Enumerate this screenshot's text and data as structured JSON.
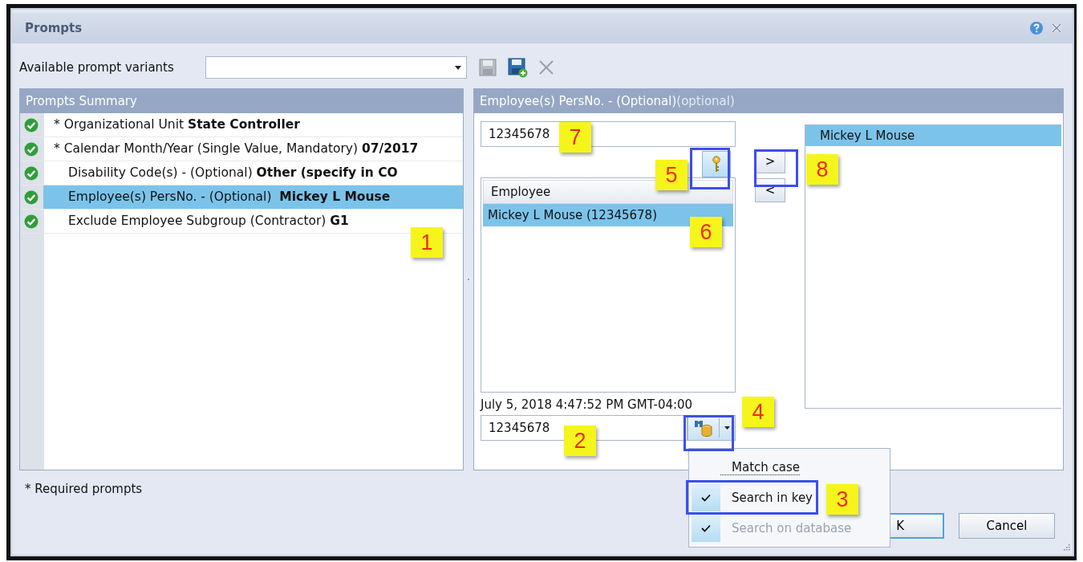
{
  "window": {
    "title": "Prompts"
  },
  "variants": {
    "label": "Available prompt variants"
  },
  "summary": {
    "title": "Prompts Summary",
    "items": [
      {
        "text": "* Organizational Unit **State Controller**",
        "required": true,
        "selected": false
      },
      {
        "text": "* Calendar Month/Year (Single Value, Mandatory) **07/2017**",
        "required": true,
        "selected": false
      },
      {
        "text": "Disability Code(s) - (Optional) **Other (specify in CO**",
        "required": false,
        "selected": false
      },
      {
        "text": "Employee(s) PersNo. - (Optional)  **Mickey L Mouse**",
        "required": false,
        "selected": true
      },
      {
        "text": "Exclude Employee Subgroup (Contractor) **G1**",
        "required": false,
        "selected": false
      }
    ]
  },
  "detail": {
    "title": "Employee(s) PersNo. - (Optional)",
    "hint": "(optional)",
    "search": {
      "value": "12345678"
    },
    "list": {
      "header": "Employee",
      "rows": [
        {
          "text": "Mickey L Mouse (12345678)",
          "selected": true
        }
      ]
    },
    "move_buttons": [
      ">",
      "<"
    ],
    "chosen": [
      {
        "text": "Mickey L Mouse",
        "selected": true
      }
    ],
    "timestamp": "July 5, 2018 4:47:52 PM GMT-04:00",
    "filter": {
      "value": "12345678"
    },
    "menu": [
      {
        "label": "Match case",
        "checked": false,
        "disabled": false
      },
      {
        "label": "Search in key",
        "checked": true,
        "disabled": false
      },
      {
        "label": "Search on database",
        "checked": true,
        "disabled": true
      }
    ]
  },
  "footer": "* Required prompts",
  "buttons": [
    "K",
    "Cancel"
  ],
  "callouts": [
    "1",
    "2",
    "3",
    "4",
    "5",
    "6",
    "7",
    "8"
  ]
}
